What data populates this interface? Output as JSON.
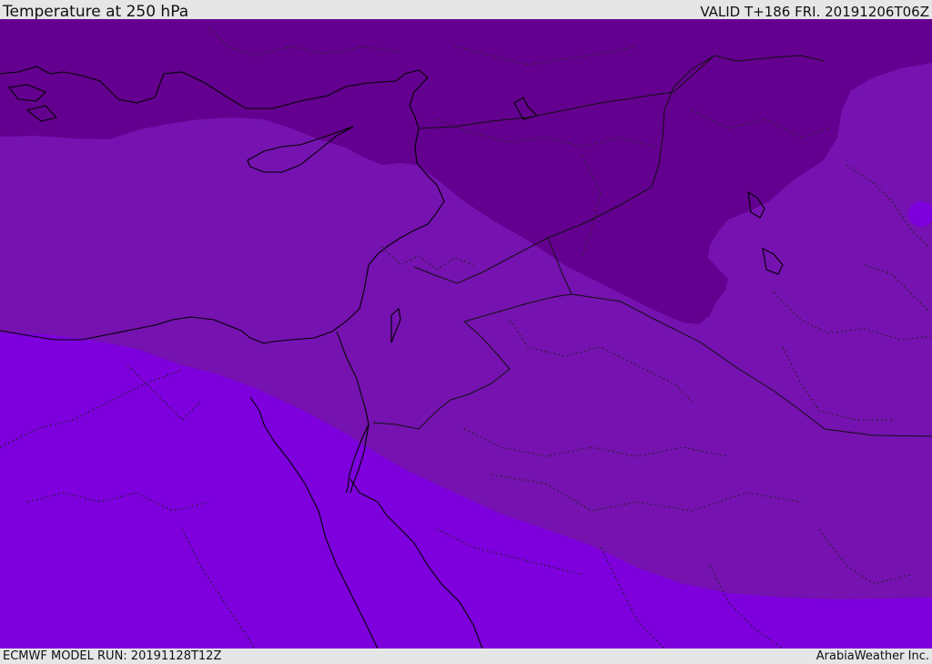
{
  "header": {
    "title": "Temperature at 250 hPa",
    "valid": "VALID T+186 FRI. 20191206T06Z"
  },
  "footer": {
    "model_run": "ECMWF MODEL RUN: 20191128T12Z",
    "credit": "ArabiaWeather Inc."
  },
  "map": {
    "variable": "temperature",
    "level": "250 hPa",
    "region": "Eastern Mediterranean / Levant",
    "colors": {
      "coldest_band": "#64008f",
      "middle_band": "#7512b0",
      "warmest_band": "#7d00dd",
      "coastline": "#000000",
      "borders": "#222222"
    }
  }
}
